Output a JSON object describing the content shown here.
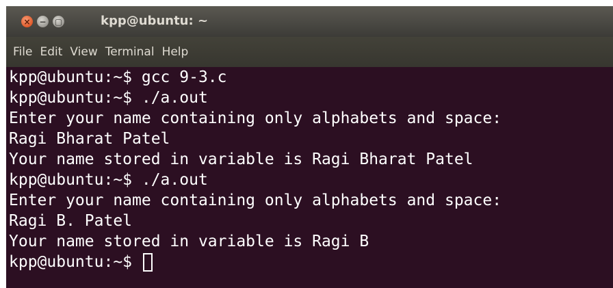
{
  "window": {
    "title": "kpp@ubuntu: ~",
    "buttons": {
      "close_glyph": "×",
      "minimize_glyph": "−",
      "maximize_glyph": "▢"
    }
  },
  "menu": {
    "items": [
      "File",
      "Edit",
      "View",
      "Terminal",
      "Help"
    ]
  },
  "terminal": {
    "lines": [
      "kpp@ubuntu:~$ gcc 9-3.c",
      "kpp@ubuntu:~$ ./a.out",
      "Enter your name containing only alphabets and space:",
      "Ragi Bharat Patel",
      "Your name stored in variable is Ragi Bharat Patel",
      "kpp@ubuntu:~$ ./a.out",
      "Enter your name containing only alphabets and space:",
      "Ragi B. Patel",
      "Your name stored in variable is Ragi B"
    ],
    "prompt": "kpp@ubuntu:~$ "
  },
  "colors": {
    "terminal_background": "#2c0f22",
    "terminal_text": "#ffffff",
    "titlebar": "#3c3b37",
    "close_button": "#e05a2a"
  }
}
